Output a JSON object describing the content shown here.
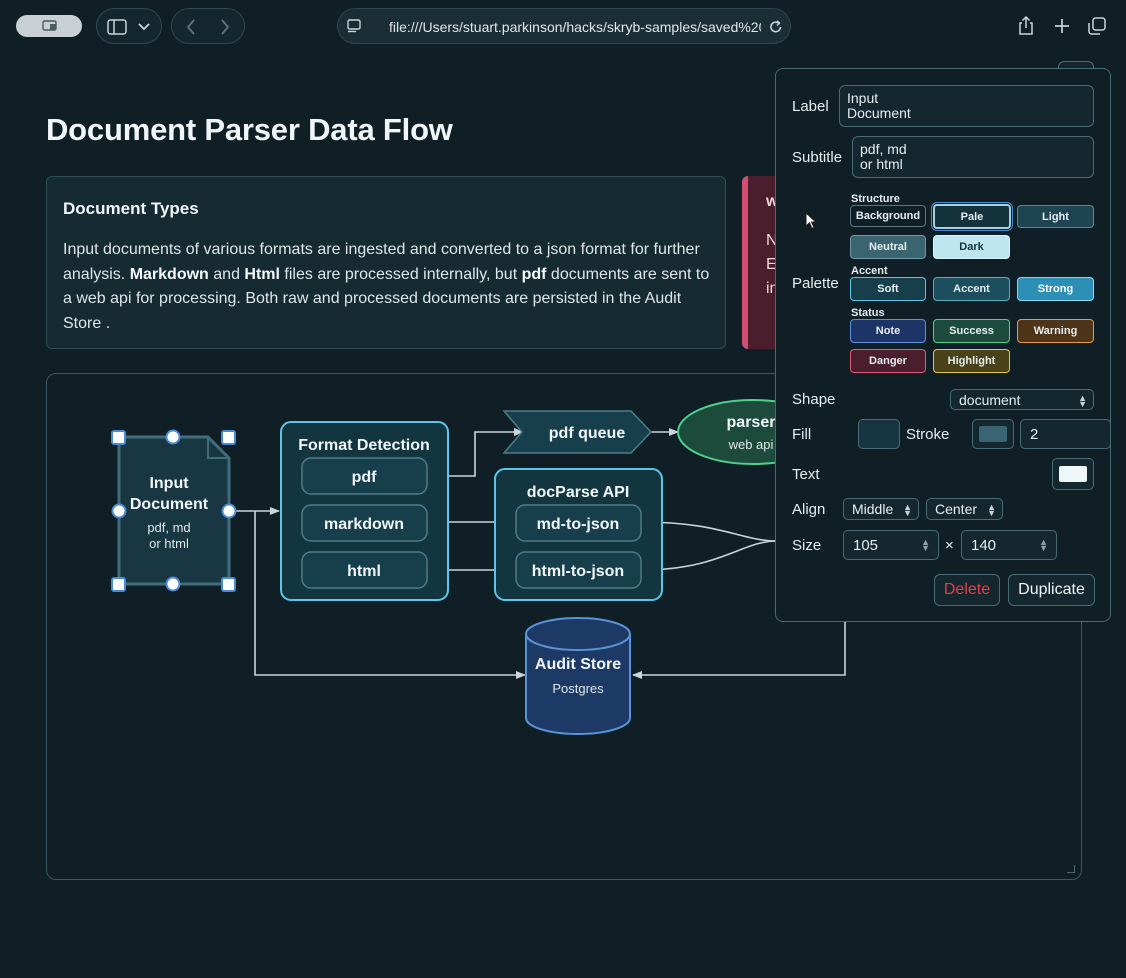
{
  "browser": {
    "url": "file:///Users/stuart.parkinson/hacks/skryb-samples/saved%20"
  },
  "page": {
    "title": "Document Parser Data Flow"
  },
  "info_card": {
    "heading": "Document Types",
    "text_1": "Input documents of various formats are ingested and converted to a json format for further analysis. ",
    "bold_1": "Markdown",
    "text_2": " and ",
    "bold_2": "Html",
    "text_3": " files are processed internally, but ",
    "bold_3": "pdf",
    "text_4": " documents are sent to a web api for processing. Both raw and processed documents are persisted in the Audit Store ."
  },
  "warning_card": {
    "line_1": "w",
    "line_2": "N",
    "line_3": "E",
    "line_4": "in"
  },
  "diagram": {
    "input_label_1": "Input",
    "input_label_2": "Document",
    "input_sub_1": "pdf, md",
    "input_sub_2": "or html",
    "format_title": "Format Detection",
    "fmt_pdf": "pdf",
    "fmt_markdown": "markdown",
    "fmt_html": "html",
    "queue_label": "pdf queue",
    "parser_label": "parser",
    "parser_sub": "web api",
    "api_title": "docParse API",
    "api_md": "md-to-json",
    "api_html": "html-to-json",
    "store_label": "Audit Store",
    "store_sub": "Postgres"
  },
  "panel": {
    "label_caption": "Label",
    "label_value": "Input\nDocument",
    "subtitle_caption": "Subtitle",
    "subtitle_value": "pdf, md\nor html",
    "palette_caption": "Palette",
    "group_structure": "Structure",
    "group_accent": "Accent",
    "group_status": "Status",
    "swatches": {
      "background": "Background",
      "pale": "Pale",
      "light": "Light",
      "neutral": "Neutral",
      "dark": "Dark",
      "soft": "Soft",
      "accent": "Accent",
      "strong": "Strong",
      "note": "Note",
      "success": "Success",
      "warning": "Warning",
      "danger": "Danger",
      "highlight": "Highlight"
    },
    "shape_caption": "Shape",
    "shape_value": "document",
    "fill_caption": "Fill",
    "stroke_caption": "Stroke",
    "stroke_width": "2",
    "text_caption": "Text",
    "align_caption": "Align",
    "align_vertical": "Middle",
    "align_horizontal": "Center",
    "size_caption": "Size",
    "size_width": "105",
    "size_times": "×",
    "size_height": "140",
    "delete_label": "Delete",
    "duplicate_label": "Duplicate"
  },
  "colors": {
    "background": "#0f1f25",
    "node_border": "#5fc4e6",
    "node_fill": "#12353f",
    "selection": "#4a8bd6",
    "parser_border": "#4fd08c",
    "store_fill": "#1d3a66",
    "danger_text": "#e0414f"
  }
}
